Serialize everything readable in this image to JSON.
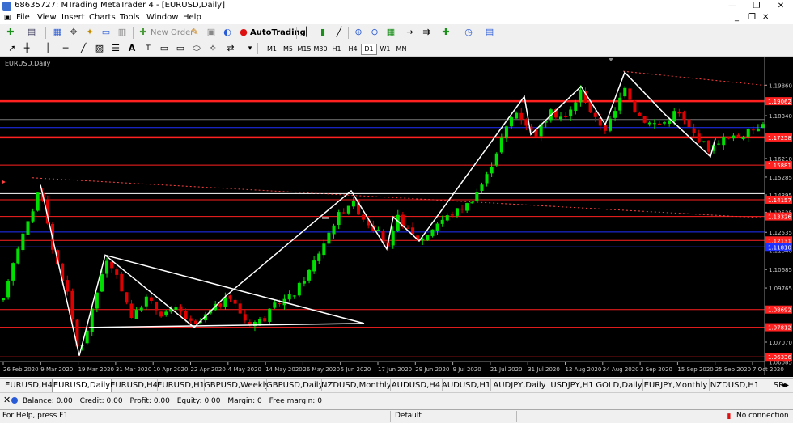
{
  "window": {
    "title": "68635727: MTrading MetaTrader 4 - [EURUSD,Daily]",
    "minimize": "—",
    "maximize": "❐",
    "close": "✕"
  },
  "menu": [
    "File",
    "View",
    "Insert",
    "Charts",
    "Tools",
    "Window",
    "Help"
  ],
  "toolbar": {
    "new_order_label": "New Order",
    "autotrading_label": "AutoTrading",
    "timeframes": [
      "M1",
      "M5",
      "M15",
      "M30",
      "H1",
      "H4",
      "D1",
      "W1",
      "MN"
    ],
    "active_timeframe": "D1"
  },
  "chart": {
    "label": "EURUSD,Daily",
    "colors": {
      "background": "#000000",
      "bull": "#00e000",
      "bear": "#e00000",
      "pattern": "#ffffff",
      "level": "#ff2020",
      "blue_level": "#2030ff"
    },
    "price_scale": [
      "1.19860",
      "1.18340",
      "1.16210",
      "1.15285",
      "1.14395",
      "1.13535",
      "1.12535",
      "1.11640",
      "1.10685",
      "1.09765",
      "1.07070",
      "1.06085"
    ],
    "highlighted_prices": [
      {
        "value": "1.19062",
        "color": "#ff2020"
      },
      {
        "value": "1.17258",
        "color": "#ff2020"
      },
      {
        "value": "1.15881",
        "color": "#ff2020"
      },
      {
        "value": "1.14157",
        "color": "#ff2020"
      },
      {
        "value": "1.13326",
        "color": "#ff2020"
      },
      {
        "value": "1.12131",
        "color": "#ff2020"
      },
      {
        "value": "1.11810",
        "color": "#2030ff"
      },
      {
        "value": "1.08692",
        "color": "#ff2020"
      },
      {
        "value": "1.07812",
        "color": "#ff2020"
      },
      {
        "value": "1.06336",
        "color": "#ff2020"
      }
    ],
    "date_axis": [
      "26 Feb 2020",
      "9 Mar 2020",
      "19 Mar 2020",
      "31 Mar 2020",
      "10 Apr 2020",
      "22 Apr 2020",
      "4 May 2020",
      "14 May 2020",
      "26 May 2020",
      "5 Jun 2020",
      "17 Jun 2020",
      "29 Jun 2020",
      "9 Jul 2020",
      "21 Jul 2020",
      "31 Jul 2020",
      "12 Aug 2020",
      "24 Aug 2020",
      "3 Sep 2020",
      "15 Sep 2020",
      "25 Sep 2020",
      "7 Oct 2020"
    ]
  },
  "tabs": [
    "EURUSD,H4",
    "EURUSD,Daily",
    "EURUSD,H4",
    "EURUSD,H1",
    "GBPUSD,Weekly",
    "GBPUSD,Daily",
    "NZDUSD,Monthly",
    "AUDUSD,H4",
    "AUDUSD,H1",
    "AUDJPY,Daily",
    "USDJPY,H1",
    "GOLD,Daily",
    "EURJPY,Monthly",
    "NZDUSD,H1",
    "SP"
  ],
  "active_tab": 1,
  "terminal": {
    "balance": "Balance: 0.00",
    "credit": "Credit: 0.00",
    "profit": "Profit: 0.00",
    "equity": "Equity: 0.00",
    "margin": "Margin: 0",
    "free_margin": "Free margin: 0"
  },
  "status": {
    "help": "For Help, press F1",
    "profile": "Default",
    "connection": "No connection"
  }
}
